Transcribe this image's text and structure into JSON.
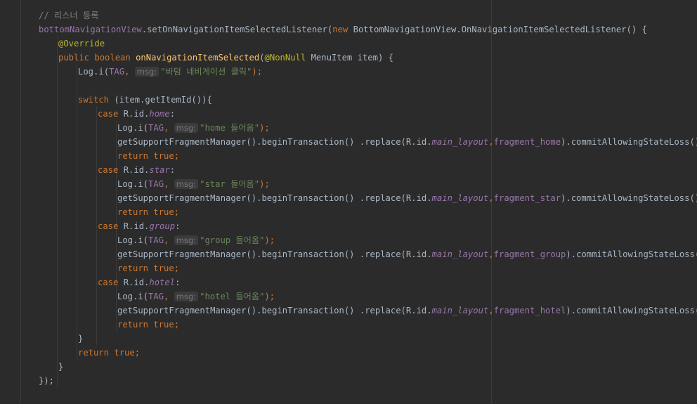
{
  "colors": {
    "background": "#2b2b2b",
    "plain": "#a9b7c6",
    "keyword": "#cc7832",
    "comment": "#808080",
    "annotation": "#bbb529",
    "method_decl": "#ffc66d",
    "string": "#6a8759",
    "field": "#9876aa"
  },
  "code": {
    "lines": [
      {
        "indent": 0,
        "tokens": [
          {
            "t": "// 리스너 등록",
            "c": "comment"
          }
        ]
      },
      {
        "indent": 0,
        "tokens": [
          {
            "t": "bottomNavigationView",
            "c": "field"
          },
          {
            "t": ".setOnNavigationItemSelectedListener(",
            "c": "plain"
          },
          {
            "t": "new ",
            "c": "keyword"
          },
          {
            "t": "BottomNavigationView.OnNavigationItemSelectedListener() {",
            "c": "plain"
          }
        ]
      },
      {
        "indent": 1,
        "tokens": [
          {
            "t": "@Override",
            "c": "annotation"
          }
        ]
      },
      {
        "indent": 1,
        "tokens": [
          {
            "t": "public boolean ",
            "c": "keyword"
          },
          {
            "t": "onNavigationItemSelected",
            "c": "method_decl"
          },
          {
            "t": "(",
            "c": "plain"
          },
          {
            "t": "@NonNull ",
            "c": "annotation"
          },
          {
            "t": "MenuItem item) {",
            "c": "plain"
          }
        ]
      },
      {
        "indent": 2,
        "tokens": [
          {
            "t": "Log.",
            "c": "plain"
          },
          {
            "t": "i",
            "c": "plain"
          },
          {
            "t": "(",
            "c": "plain"
          },
          {
            "t": "TAG",
            "c": "field"
          },
          {
            "t": ", ",
            "c": "keyword"
          },
          {
            "t": "msg:",
            "c": "hint"
          },
          {
            "t": "\"바텀 네비게이션 클릭\"",
            "c": "string"
          },
          {
            "t": ");",
            "c": "keyword"
          }
        ]
      },
      {
        "indent": 0,
        "tokens": []
      },
      {
        "indent": 2,
        "tokens": [
          {
            "t": "switch ",
            "c": "keyword"
          },
          {
            "t": "(item.getItemId()){",
            "c": "plain"
          }
        ]
      },
      {
        "indent": 3,
        "tokens": [
          {
            "t": "case ",
            "c": "keyword"
          },
          {
            "t": "R.id.",
            "c": "plain"
          },
          {
            "t": "home",
            "c": "field_italic"
          },
          {
            "t": ":",
            "c": "plain"
          }
        ]
      },
      {
        "indent": 4,
        "tokens": [
          {
            "t": "Log.i(",
            "c": "plain"
          },
          {
            "t": "TAG",
            "c": "field"
          },
          {
            "t": ", ",
            "c": "keyword"
          },
          {
            "t": "msg:",
            "c": "hint"
          },
          {
            "t": "\"home 들어옴\"",
            "c": "string"
          },
          {
            "t": ");",
            "c": "keyword"
          }
        ]
      },
      {
        "indent": 4,
        "tokens": [
          {
            "t": "getSupportFragmentManager().beginTransaction() .replace(R.id.",
            "c": "plain"
          },
          {
            "t": "main_layout",
            "c": "field_italic"
          },
          {
            "t": ",",
            "c": "keyword"
          },
          {
            "t": "fragment_home",
            "c": "field"
          },
          {
            "t": ").commitAllowingStateLoss()",
            "c": "plain"
          },
          {
            "t": ";",
            "c": "keyword"
          }
        ]
      },
      {
        "indent": 4,
        "tokens": [
          {
            "t": "return true;",
            "c": "keyword"
          }
        ]
      },
      {
        "indent": 3,
        "tokens": [
          {
            "t": "case ",
            "c": "keyword"
          },
          {
            "t": "R.id.",
            "c": "plain"
          },
          {
            "t": "star",
            "c": "field_italic"
          },
          {
            "t": ":",
            "c": "plain"
          }
        ]
      },
      {
        "indent": 4,
        "tokens": [
          {
            "t": "Log.i(",
            "c": "plain"
          },
          {
            "t": "TAG",
            "c": "field"
          },
          {
            "t": ", ",
            "c": "keyword"
          },
          {
            "t": "msg:",
            "c": "hint"
          },
          {
            "t": "\"star 들어옴\"",
            "c": "string"
          },
          {
            "t": ");",
            "c": "keyword"
          }
        ]
      },
      {
        "indent": 4,
        "tokens": [
          {
            "t": "getSupportFragmentManager().beginTransaction() .replace(R.id.",
            "c": "plain"
          },
          {
            "t": "main_layout",
            "c": "field_italic"
          },
          {
            "t": ",",
            "c": "keyword"
          },
          {
            "t": "fragment_star",
            "c": "field"
          },
          {
            "t": ").commitAllowingStateLoss()",
            "c": "plain"
          },
          {
            "t": ";",
            "c": "keyword"
          }
        ]
      },
      {
        "indent": 4,
        "tokens": [
          {
            "t": "return true;",
            "c": "keyword"
          }
        ]
      },
      {
        "indent": 3,
        "tokens": [
          {
            "t": "case ",
            "c": "keyword"
          },
          {
            "t": "R.id.",
            "c": "plain"
          },
          {
            "t": "group",
            "c": "field_italic"
          },
          {
            "t": ":",
            "c": "plain"
          }
        ]
      },
      {
        "indent": 4,
        "tokens": [
          {
            "t": "Log.i(",
            "c": "plain"
          },
          {
            "t": "TAG",
            "c": "field"
          },
          {
            "t": ", ",
            "c": "keyword"
          },
          {
            "t": "msg:",
            "c": "hint"
          },
          {
            "t": "\"group 들어옴\"",
            "c": "string"
          },
          {
            "t": ");",
            "c": "keyword"
          }
        ]
      },
      {
        "indent": 4,
        "tokens": [
          {
            "t": "getSupportFragmentManager().beginTransaction() .replace(R.id.",
            "c": "plain"
          },
          {
            "t": "main_layout",
            "c": "field_italic"
          },
          {
            "t": ",",
            "c": "keyword"
          },
          {
            "t": "fragment_group",
            "c": "field"
          },
          {
            "t": ").commitAllowingStateLoss()",
            "c": "plain"
          },
          {
            "t": ";",
            "c": "keyword"
          }
        ]
      },
      {
        "indent": 4,
        "tokens": [
          {
            "t": "return true;",
            "c": "keyword"
          }
        ]
      },
      {
        "indent": 3,
        "tokens": [
          {
            "t": "case ",
            "c": "keyword"
          },
          {
            "t": "R.id.",
            "c": "plain"
          },
          {
            "t": "hotel",
            "c": "field_italic"
          },
          {
            "t": ":",
            "c": "plain"
          }
        ]
      },
      {
        "indent": 4,
        "tokens": [
          {
            "t": "Log.i(",
            "c": "plain"
          },
          {
            "t": "TAG",
            "c": "field"
          },
          {
            "t": ", ",
            "c": "keyword"
          },
          {
            "t": "msg:",
            "c": "hint"
          },
          {
            "t": "\"hotel 들어옴\"",
            "c": "string"
          },
          {
            "t": ");",
            "c": "keyword"
          }
        ]
      },
      {
        "indent": 4,
        "tokens": [
          {
            "t": "getSupportFragmentManager().beginTransaction() .replace(R.id.",
            "c": "plain"
          },
          {
            "t": "main_layout",
            "c": "field_italic"
          },
          {
            "t": ",",
            "c": "keyword"
          },
          {
            "t": "fragment_hotel",
            "c": "field"
          },
          {
            "t": ").commitAllowingStateLoss()",
            "c": "plain"
          },
          {
            "t": ";",
            "c": "keyword"
          }
        ]
      },
      {
        "indent": 4,
        "tokens": [
          {
            "t": "return true;",
            "c": "keyword"
          }
        ]
      },
      {
        "indent": 2,
        "tokens": [
          {
            "t": "}",
            "c": "plain"
          }
        ]
      },
      {
        "indent": 2,
        "tokens": [
          {
            "t": "return true;",
            "c": "keyword"
          }
        ]
      },
      {
        "indent": 1,
        "tokens": [
          {
            "t": "}",
            "c": "plain"
          }
        ]
      },
      {
        "indent": 0,
        "tokens": [
          {
            "t": "});",
            "c": "plain"
          }
        ]
      }
    ]
  }
}
